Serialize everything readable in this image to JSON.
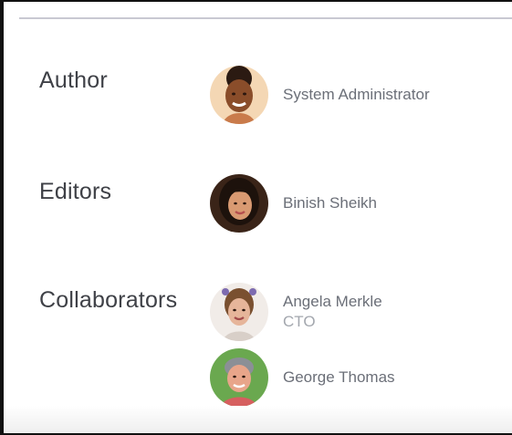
{
  "sections": {
    "author": {
      "label": "Author",
      "people": [
        {
          "name": "System Administrator",
          "avatar_icon": "avatar-system-administrator"
        }
      ]
    },
    "editors": {
      "label": "Editors",
      "people": [
        {
          "name": "Binish Sheikh",
          "avatar_icon": "avatar-binish-sheikh"
        }
      ]
    },
    "collaborators": {
      "label": "Collaborators",
      "people": [
        {
          "name": "Angela Merkle",
          "role": "CTO",
          "avatar_icon": "avatar-angela-merkle"
        },
        {
          "name": "George Thomas",
          "avatar_icon": "avatar-george-thomas"
        }
      ]
    }
  },
  "colors": {
    "label_text": "#3f4147",
    "name_text": "#6b6f78",
    "role_text": "#a3a7ae",
    "divider": "#c9c9d2"
  }
}
